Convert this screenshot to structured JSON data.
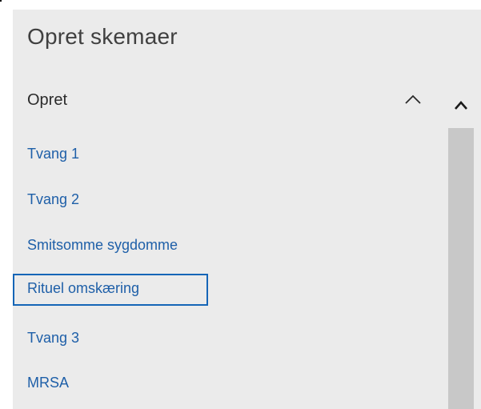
{
  "stray_mark": ".",
  "panel": {
    "title": "Opret skemaer",
    "background": "#ebebeb"
  },
  "section": {
    "label": "Opret",
    "icon": "chevron-up-icon",
    "expanded": true
  },
  "items": [
    {
      "label": "Tvang 1",
      "selected": false
    },
    {
      "label": "Tvang 2",
      "selected": false
    },
    {
      "label": "Smitsomme sygdomme",
      "selected": false
    },
    {
      "label": "Rituel omskæring",
      "selected": true
    },
    {
      "label": "Tvang 3",
      "selected": false
    },
    {
      "label": "MRSA",
      "selected": false
    }
  ],
  "colors": {
    "link": "#1e5fa8",
    "focus_border": "#1565b7",
    "scrollbar_thumb": "#c8c8c8"
  },
  "scrollbar": {
    "up_icon": "chevron-up-icon"
  }
}
